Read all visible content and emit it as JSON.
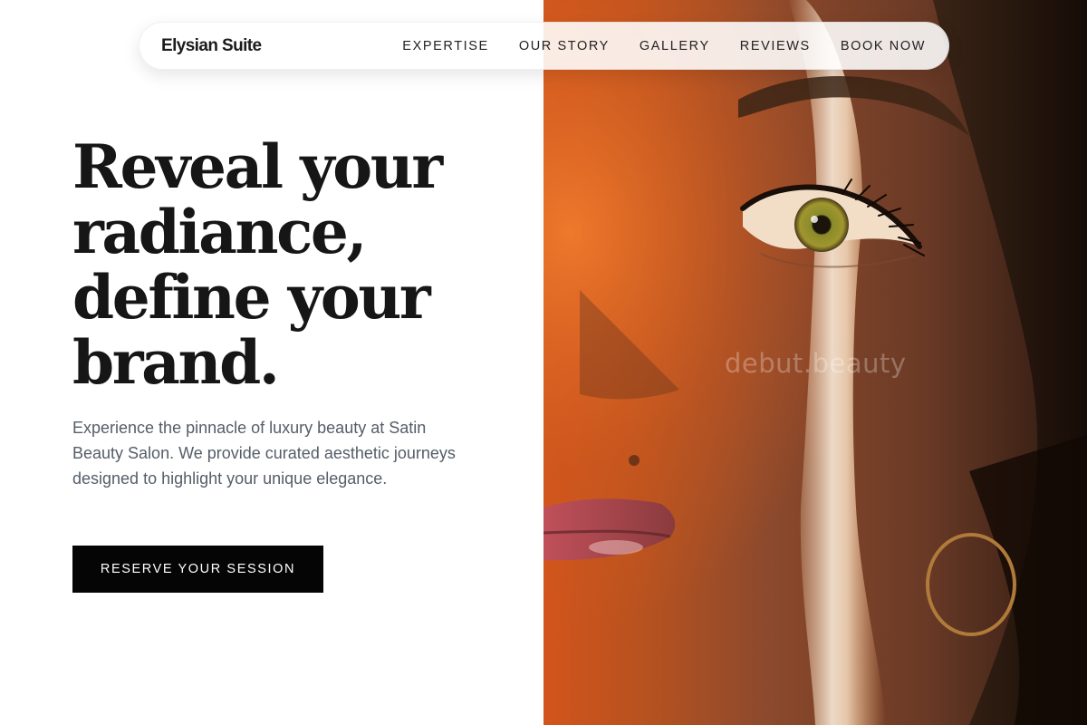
{
  "header": {
    "brand": "Elysian Suite",
    "nav": [
      {
        "label": "EXPERTISE"
      },
      {
        "label": "OUR STORY"
      },
      {
        "label": "GALLERY"
      },
      {
        "label": "REVIEWS"
      },
      {
        "label": "BOOK NOW"
      }
    ]
  },
  "hero": {
    "title_lines": [
      "Reveal your",
      "radiance,",
      "define your",
      "brand."
    ],
    "description": "Experience the pinnacle of luxury beauty at Satin Beauty Salon. We provide curated aesthetic journeys designed to highlight your unique elegance.",
    "cta_label": "RESERVE YOUR SESSION"
  },
  "image": {
    "watermark": "debut.beauty"
  },
  "colors": {
    "cta_background": "#050505",
    "title_text": "#161616",
    "body_text": "#555d68"
  }
}
